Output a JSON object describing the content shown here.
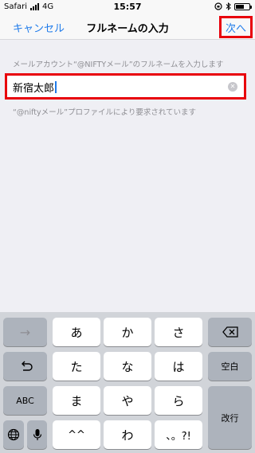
{
  "status_bar": {
    "carrier": "Safari",
    "network": "4G",
    "time": "15:57",
    "icons": [
      "signal-icon",
      "orientation-lock-icon",
      "bluetooth-icon",
      "battery-icon"
    ]
  },
  "nav": {
    "cancel_label": "キャンセル",
    "title": "フルネームの入力",
    "next_label": "次へ",
    "accent_color": "#1f7bea",
    "highlight_color": "#e8000b"
  },
  "content": {
    "description": "メールアカウント“@NIFTYメール”のフルネームを入力します",
    "input_value": "新宿太郎",
    "note": "“@niftyメール”プロファイルにより要求されています"
  },
  "keyboard": {
    "rows": [
      [
        "→",
        "あ",
        "か",
        "さ",
        "delete"
      ],
      [
        "undo",
        "た",
        "な",
        "は",
        "空白"
      ],
      [
        "ABC",
        "ま",
        "や",
        "ら",
        "改行"
      ],
      [
        "globe",
        "mic",
        "^^",
        "わ",
        "、。?!"
      ]
    ],
    "keys": {
      "arrow": "→",
      "a": "あ",
      "ka": "か",
      "sa": "さ",
      "ta": "た",
      "na": "な",
      "ha": "は",
      "space": "空白",
      "abc": "ABC",
      "ma": "ま",
      "ya": "や",
      "ra": "ら",
      "return": "改行",
      "kaomoji": "^^",
      "wa": "わ",
      "punct": "、。?!"
    }
  }
}
